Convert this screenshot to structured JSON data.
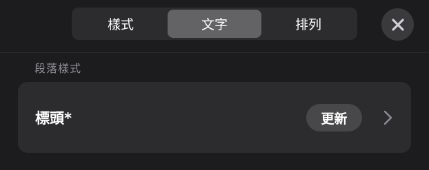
{
  "tabs": [
    {
      "label": "樣式",
      "active": false
    },
    {
      "label": "文字",
      "active": true
    },
    {
      "label": "排列",
      "active": false
    }
  ],
  "close_icon": "close-icon",
  "section": {
    "label": "段落樣式"
  },
  "paragraph_style": {
    "name": "標頭*",
    "update_label": "更新",
    "chevron_icon": "chevron-right-icon"
  },
  "colors": {
    "background": "#1c1c1e",
    "control_bg": "#2c2c2e",
    "active_segment": "#636366",
    "secondary_text": "#8e8e93"
  }
}
